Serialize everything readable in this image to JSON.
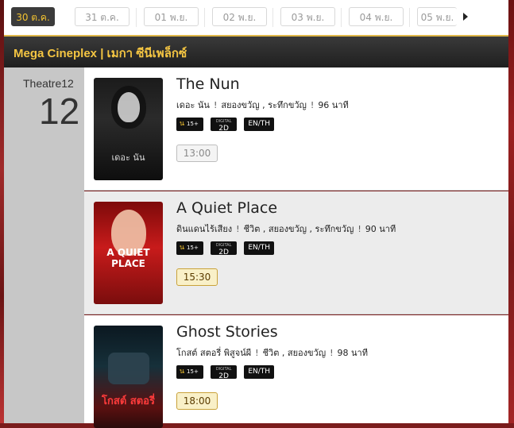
{
  "dates": [
    "30 ต.ค.",
    "31 ต.ค.",
    "01 พ.ย.",
    "02 พ.ย.",
    "03 พ.ย.",
    "04 พ.ย.",
    "05 พ.ย."
  ],
  "active_date_index": 0,
  "cinema": {
    "name": "Mega Cineplex | เมกา ซีนีเพล็กซ์"
  },
  "theatre": {
    "label": "Theatre12",
    "number": "12"
  },
  "movies": [
    {
      "title": "The Nun",
      "thai_title": "เดอะ นัน",
      "genre": "สยองขวัญ , ระทึกขวัญ",
      "duration": "96 นาที",
      "rating": "น",
      "rating_age": "15+",
      "format": "2D",
      "format_top": "DIGITAL",
      "language": "EN/TH",
      "poster_text": "เดอะ นัน",
      "showtime": "13:00",
      "showtime_state": "past"
    },
    {
      "title": "A Quiet Place",
      "thai_title": "ดินแดนไร้เสียง",
      "genre": "ชีวิต , สยองขวัญ , ระทึกขวัญ",
      "duration": "90 นาที",
      "rating": "น",
      "rating_age": "15+",
      "format": "2D",
      "format_top": "DIGITAL",
      "language": "EN/TH",
      "poster_text": "A QUIET PLACE",
      "showtime": "15:30",
      "showtime_state": "open"
    },
    {
      "title": "Ghost Stories",
      "thai_title": "โกสต์ สตอรี่ พิสูจน์ผี",
      "genre": "ชีวิต , สยองขวัญ",
      "duration": "98 นาที",
      "rating": "น",
      "rating_age": "15+",
      "format": "2D",
      "format_top": "DIGITAL",
      "language": "EN/TH",
      "poster_text": "โกสต์ สตอรี่",
      "showtime": "18:00",
      "showtime_state": "open"
    }
  ],
  "colors": {
    "accent": "#f2c230",
    "header_bg": "#2a2a2a",
    "theatre_bg": "#c7c7c7"
  }
}
